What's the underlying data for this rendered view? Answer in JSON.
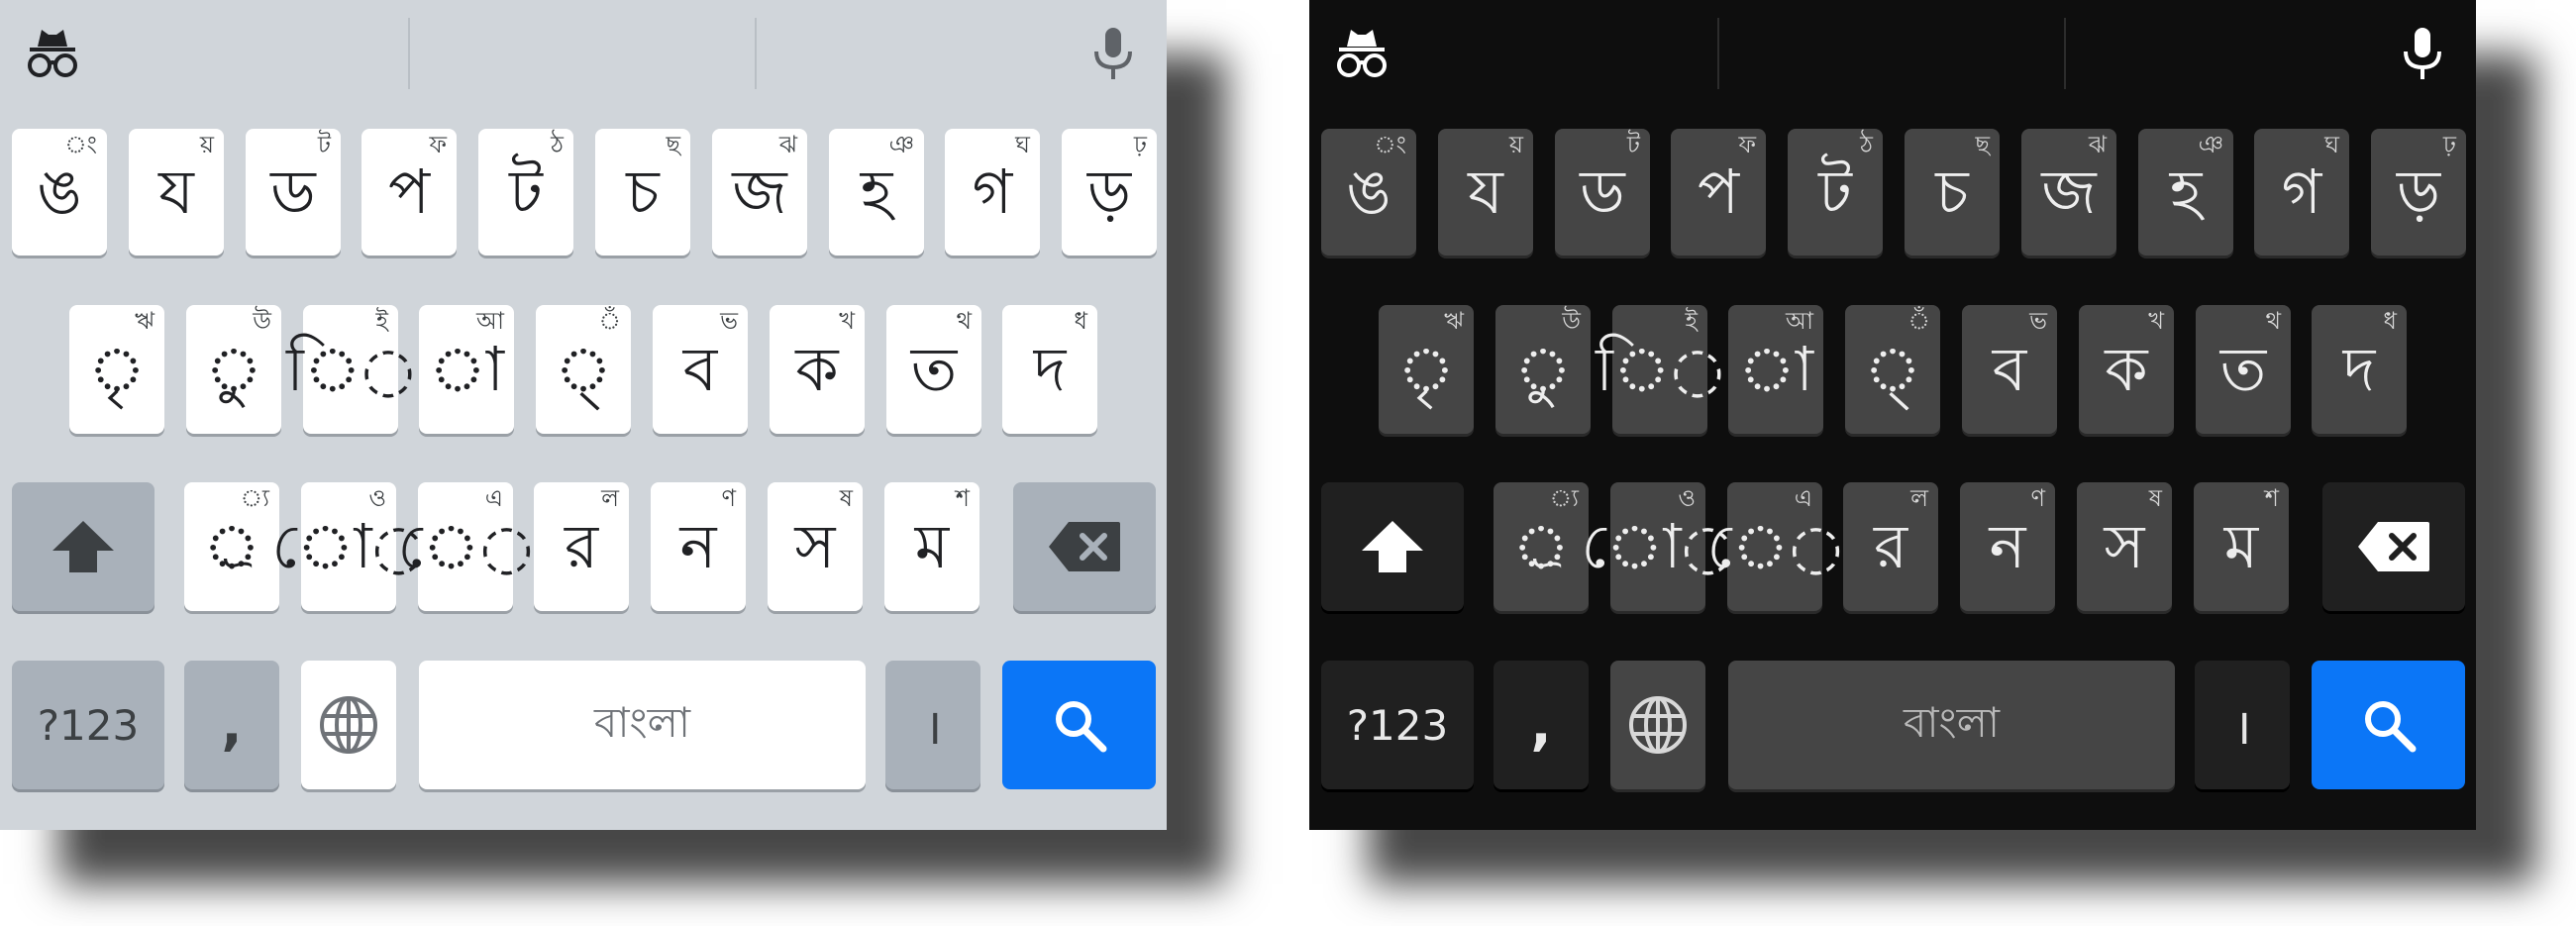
{
  "themes": [
    {
      "id": "light",
      "name": "light"
    },
    {
      "id": "dark",
      "name": "dark"
    }
  ],
  "toolbar": {
    "left_icon": "incognito-icon",
    "right_icon": "microphone-icon"
  },
  "rows": [
    [
      {
        "main": "ঙ",
        "hint": "ং"
      },
      {
        "main": "য",
        "hint": "য়"
      },
      {
        "main": "ড",
        "hint": "ট"
      },
      {
        "main": "প",
        "hint": "ফ"
      },
      {
        "main": "ট",
        "hint": "ঠ"
      },
      {
        "main": "চ",
        "hint": "ছ"
      },
      {
        "main": "জ",
        "hint": "ঝ"
      },
      {
        "main": "হ",
        "hint": "ঞ"
      },
      {
        "main": "গ",
        "hint": "ঘ"
      },
      {
        "main": "ড়",
        "hint": "ঢ়"
      }
    ],
    [
      {
        "main": "◌ৃ",
        "hint": "ঋ"
      },
      {
        "main": "◌ু",
        "hint": "উ"
      },
      {
        "main": "ি◌",
        "hint": "ই"
      },
      {
        "main": "◌া",
        "hint": "আ"
      },
      {
        "main": "◌্",
        "hint": "◌ঁ"
      },
      {
        "main": "ব",
        "hint": "ভ"
      },
      {
        "main": "ক",
        "hint": "খ"
      },
      {
        "main": "ত",
        "hint": "থ"
      },
      {
        "main": "দ",
        "hint": "ধ"
      }
    ],
    [
      {
        "main": "◌্র",
        "hint": "্য"
      },
      {
        "main": "ো◌",
        "hint": "ও"
      },
      {
        "main": "ে◌",
        "hint": "এ"
      },
      {
        "main": "র",
        "hint": "ল"
      },
      {
        "main": "ন",
        "hint": "ণ"
      },
      {
        "main": "স",
        "hint": "ষ"
      },
      {
        "main": "ম",
        "hint": "শ"
      }
    ]
  ],
  "bottom": {
    "symbols_label": "?123",
    "comma_label": ",",
    "space_label": "বাংলা",
    "danda_label": "।"
  },
  "icons": {
    "shift": "shift-icon",
    "backspace": "backspace-icon",
    "globe": "globe-icon",
    "search": "search-icon"
  },
  "colors": {
    "light_bg": "#d0d5da",
    "dark_bg": "#0e0e0e",
    "accent": "#0b76f7"
  }
}
